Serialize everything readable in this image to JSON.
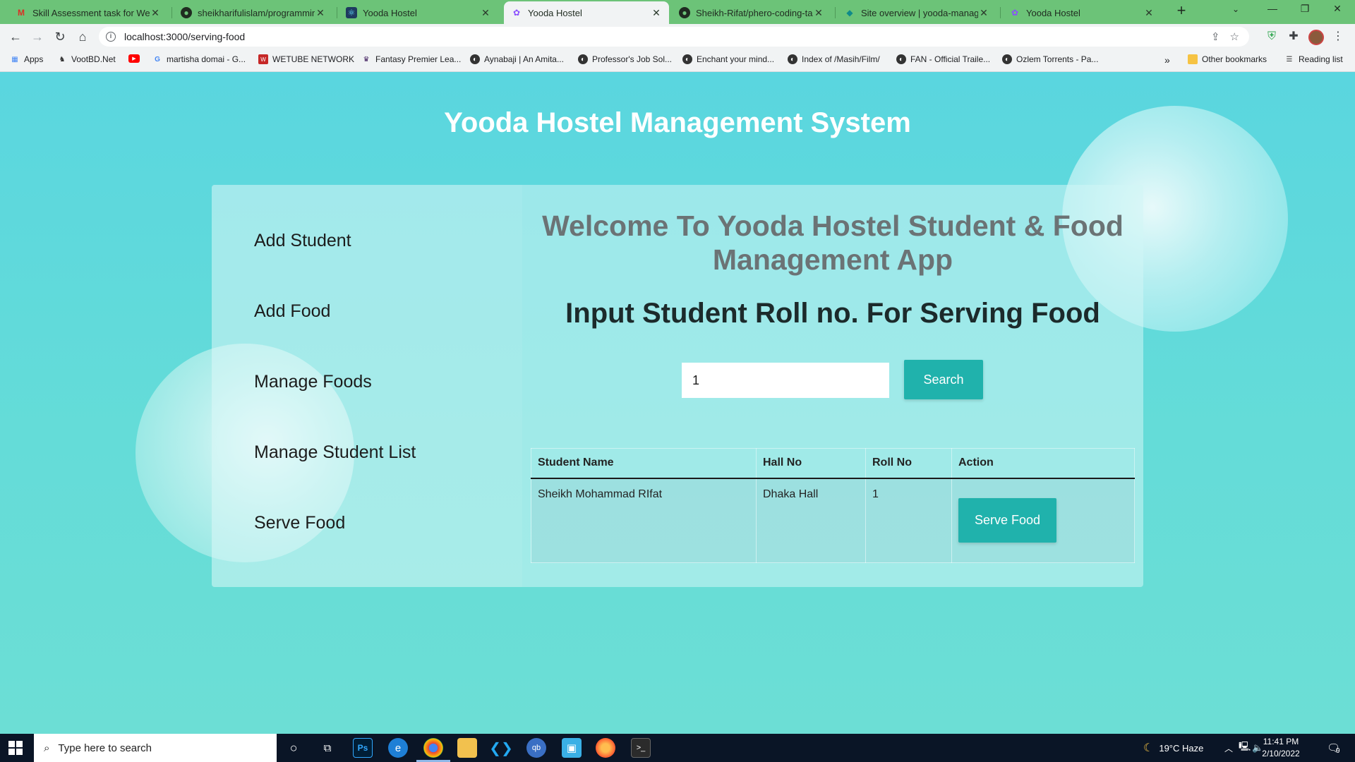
{
  "browser": {
    "tabs": [
      {
        "title": "Skill Assessment task for Web In",
        "favicon": "gmail-icon",
        "active": false
      },
      {
        "title": "sheikharifulislam/programmin-h",
        "favicon": "github-icon",
        "active": false
      },
      {
        "title": "Yooda Hostel",
        "favicon": "react-icon",
        "active": false
      },
      {
        "title": "Yooda Hostel",
        "favicon": "app-icon",
        "active": true
      },
      {
        "title": "Sheikh-Rifat/phero-coding-task",
        "favicon": "github-icon",
        "active": false
      },
      {
        "title": "Site overview | yooda-managem",
        "favicon": "netlify-icon",
        "active": false
      },
      {
        "title": "Yooda Hostel",
        "favicon": "app-icon",
        "active": false
      }
    ],
    "url": "localhost:3000/serving-food",
    "bookmarks": [
      {
        "label": "Apps"
      },
      {
        "label": "VootBD.Net"
      },
      {
        "label": ""
      },
      {
        "label": "martisha domai - G..."
      },
      {
        "label": "WETUBE NETWORK"
      },
      {
        "label": "Fantasy Premier Lea..."
      },
      {
        "label": "Aynabaji | An Amita..."
      },
      {
        "label": "Professor's Job Sol..."
      },
      {
        "label": "Enchant your mind..."
      },
      {
        "label": "Index of /Masih/Film/"
      },
      {
        "label": "FAN - Official Traile..."
      },
      {
        "label": "Ozlem Torrents - Pa..."
      }
    ],
    "other_bookmarks": "Other bookmarks",
    "reading_list": "Reading list",
    "overflow": "»"
  },
  "page": {
    "app_title": "Yooda Hostel Management System",
    "sidebar": {
      "items": [
        {
          "label": "Add Student"
        },
        {
          "label": "Add Food"
        },
        {
          "label": "Manage Foods"
        },
        {
          "label": "Manage Student List"
        },
        {
          "label": "Serve Food"
        }
      ]
    },
    "main": {
      "welcome_line1": "Welcome To Yooda Hostel Student & Food",
      "welcome_line2": "Management App",
      "subheading": "Input Student Roll no. For Serving Food",
      "roll_input_value": "1",
      "search_label": "Search",
      "table": {
        "headers": [
          "Student Name",
          "Hall No",
          "Roll No",
          "Action"
        ],
        "rows": [
          {
            "name": "Sheikh Mohammad RIfat",
            "hall": "Dhaka Hall",
            "roll": "1",
            "action_label": "Serve Food"
          }
        ]
      }
    }
  },
  "taskbar": {
    "search_placeholder": "Type here to search",
    "weather": "19°C  Haze",
    "time": "11:41 PM",
    "date": "2/10/2022",
    "notifications": "9"
  },
  "colors": {
    "page_bg": "#5bd6d6",
    "accent_button": "#20b2ac",
    "tab_strip": "#6cc378"
  }
}
